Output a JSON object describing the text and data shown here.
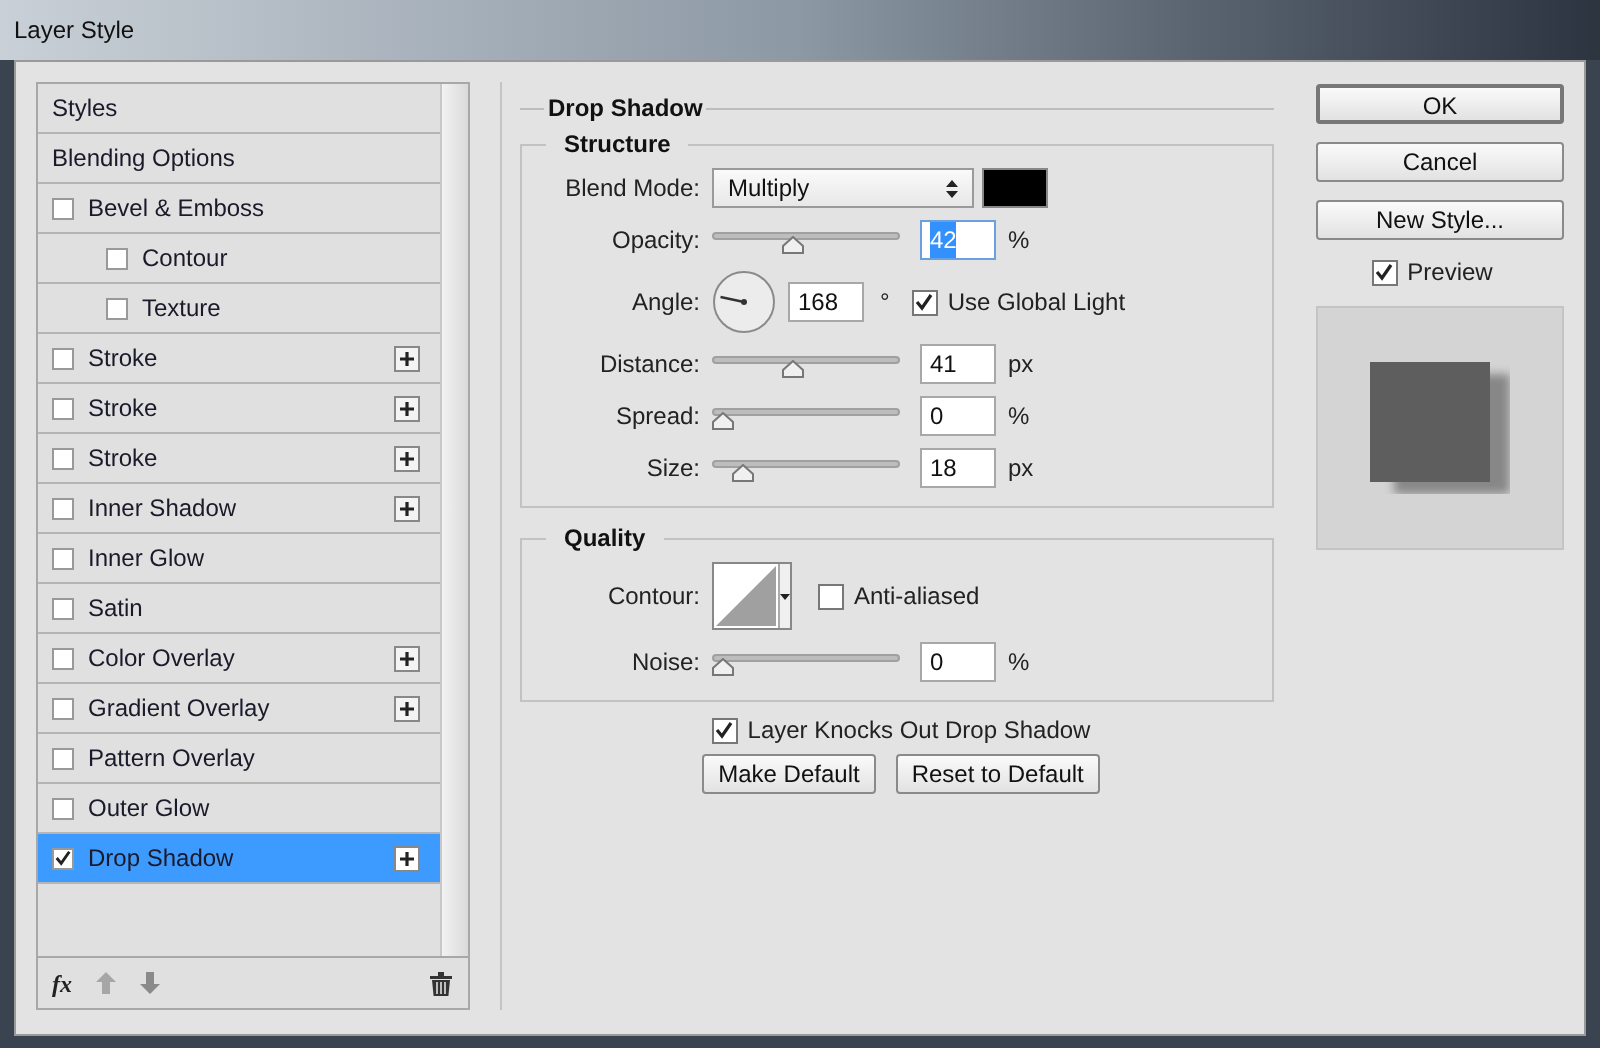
{
  "window": {
    "title": "Layer Style"
  },
  "effects": [
    {
      "label": "Styles",
      "kind": "header",
      "selected": false
    },
    {
      "label": "Blending Options",
      "kind": "header",
      "selected": false
    },
    {
      "label": "Bevel & Emboss",
      "kind": "effect",
      "checked": false,
      "selected": false,
      "addable": false,
      "children": [
        {
          "label": "Contour",
          "kind": "effect",
          "checked": false,
          "selected": false,
          "addable": false
        },
        {
          "label": "Texture",
          "kind": "effect",
          "checked": false,
          "selected": false,
          "addable": false
        }
      ]
    },
    {
      "label": "Stroke",
      "kind": "effect",
      "checked": false,
      "selected": false,
      "addable": true
    },
    {
      "label": "Stroke",
      "kind": "effect",
      "checked": false,
      "selected": false,
      "addable": true
    },
    {
      "label": "Stroke",
      "kind": "effect",
      "checked": false,
      "selected": false,
      "addable": true
    },
    {
      "label": "Inner Shadow",
      "kind": "effect",
      "checked": false,
      "selected": false,
      "addable": true
    },
    {
      "label": "Inner Glow",
      "kind": "effect",
      "checked": false,
      "selected": false,
      "addable": false
    },
    {
      "label": "Satin",
      "kind": "effect",
      "checked": false,
      "selected": false,
      "addable": false
    },
    {
      "label": "Color Overlay",
      "kind": "effect",
      "checked": false,
      "selected": false,
      "addable": true
    },
    {
      "label": "Gradient Overlay",
      "kind": "effect",
      "checked": false,
      "selected": false,
      "addable": true
    },
    {
      "label": "Pattern Overlay",
      "kind": "effect",
      "checked": false,
      "selected": false,
      "addable": false
    },
    {
      "label": "Outer Glow",
      "kind": "effect",
      "checked": false,
      "selected": false,
      "addable": false
    },
    {
      "label": "Drop Shadow",
      "kind": "effect",
      "checked": true,
      "selected": true,
      "addable": true
    }
  ],
  "list_toolbar": {
    "fx_label": "fx"
  },
  "panel": {
    "title": "Drop Shadow",
    "structure": {
      "title": "Structure",
      "blend_mode": {
        "label": "Blend Mode:",
        "value": "Multiply",
        "color": "#000000"
      },
      "opacity": {
        "label": "Opacity:",
        "level": 0.42,
        "value": "42",
        "unit": "%",
        "value_selected": true
      },
      "angle": {
        "label": "Angle:",
        "value": "168",
        "unit": "°",
        "global_light": {
          "label": "Use Global Light",
          "checked": true
        }
      },
      "distance": {
        "label": "Distance:",
        "level": 0.42,
        "value": "41",
        "unit": "px",
        "value_selected": false
      },
      "spread": {
        "label": "Spread:",
        "level": 0,
        "value": "0",
        "unit": "%",
        "value_selected": false
      },
      "size": {
        "label": "Size:",
        "level": 0.12,
        "value": "18",
        "unit": "px",
        "value_selected": false
      }
    },
    "quality": {
      "title": "Quality",
      "contour": {
        "label": "Contour:",
        "anti_aliased": {
          "label": "Anti-aliased",
          "checked": false
        }
      },
      "noise": {
        "label": "Noise:",
        "level": 0,
        "value": "0",
        "unit": "%",
        "value_selected": false
      }
    },
    "knockout": {
      "label": "Layer Knocks Out Drop Shadow",
      "checked": true
    },
    "buttons": [
      "Make Default",
      "Reset to Default"
    ]
  },
  "actions": {
    "buttons": [
      {
        "label": "OK",
        "default": true
      },
      {
        "label": "Cancel",
        "default": false
      },
      {
        "label": "New Style...",
        "default": false
      }
    ],
    "preview": {
      "label": "Preview",
      "checked": true
    }
  }
}
